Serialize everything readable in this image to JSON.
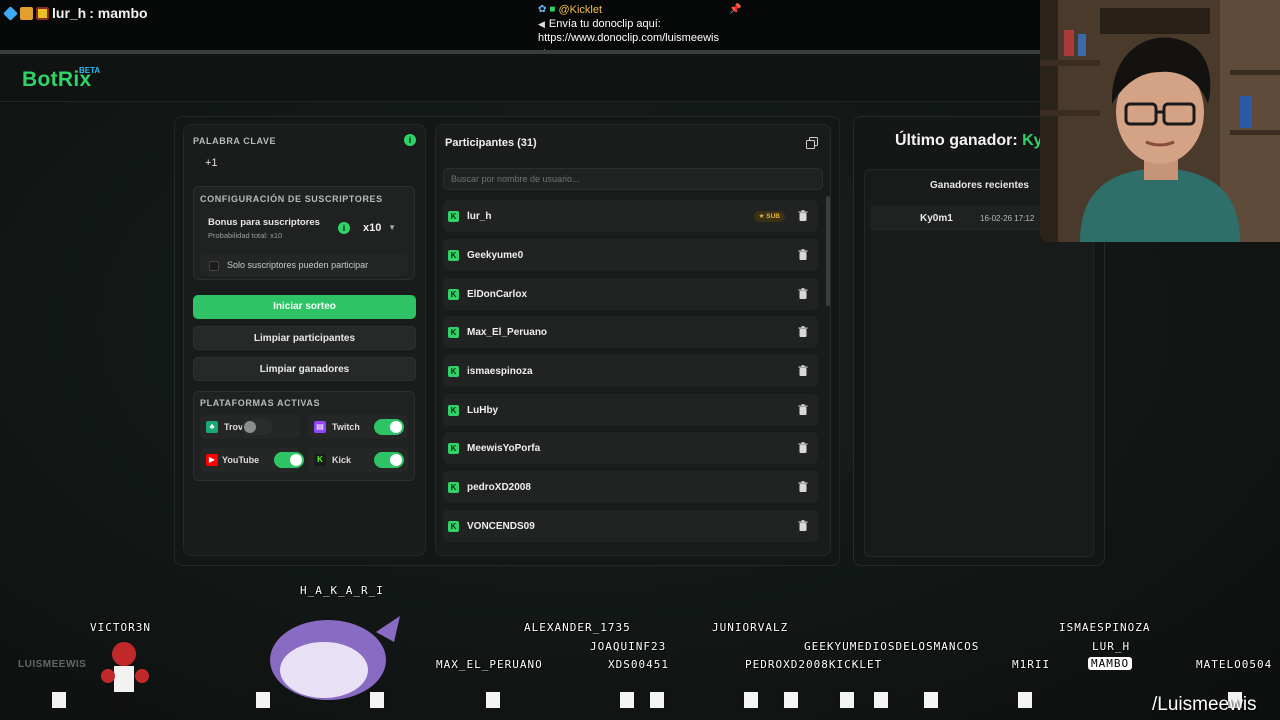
{
  "stream": {
    "chat_user": "lur_h",
    "chat_message": ": mambo",
    "alert_user": "@Kicklet",
    "alert_line1": "Envía tu donoclip aquí:",
    "alert_line2": "https://www.donoclip.com/luismeewis",
    "watermark": "/Luismeewis",
    "brand_watermark": "LUISMEEWIS"
  },
  "app": {
    "logo": "BotRix",
    "beta": "BETA"
  },
  "left_panel": {
    "keyword_label": "PALABRA CLAVE",
    "keyword_value": "+1",
    "sub_config_label": "CONFIGURACIÓN DE SUSCRIPTORES",
    "bonus_title": "Bonus para suscriptores",
    "bonus_sub": "Probabilidad total: x10",
    "multiplier": "x10",
    "sub_only_label": "Solo suscriptores pueden participar",
    "start_button": "Iniciar sorteo",
    "clear_participants": "Limpiar participantes",
    "clear_winners": "Limpiar ganadores",
    "platforms_label": "PLATAFORMAS ACTIVAS",
    "platforms": [
      {
        "name": "Trovo",
        "enabled": false,
        "color": "#19a974"
      },
      {
        "name": "Twitch",
        "enabled": true,
        "color": "#9146ff"
      },
      {
        "name": "YouTube",
        "enabled": true,
        "color": "#ff0000"
      },
      {
        "name": "Kick",
        "enabled": true,
        "color": "#53fc18"
      }
    ]
  },
  "participants": {
    "title": "Participantes (31)",
    "search_placeholder": "Buscar por nombre de usuario...",
    "sub_tag": "★ SUB",
    "list": [
      "lur_h",
      "Geekyume0",
      "ElDonCarlox",
      "Max_El_Peruano",
      "ismaespinoza",
      "LuHby",
      "MeewisYoPorfa",
      "pedroXD2008",
      "VONCENDS09"
    ]
  },
  "winners": {
    "title_prefix": "Último ganador: ",
    "last_winner": "Ky0",
    "recent_title": "Ganadores recientes",
    "recent": [
      {
        "name": "Ky0m1",
        "date": "16-02-26 17:12"
      }
    ]
  },
  "bottom_names": [
    "H_A_K_A_R_I",
    "VICTOR3N",
    "ALEXANDER_1735",
    "JUNIORVALZ",
    "ISMAESPINOZA",
    "JOAQUINF23",
    "GEEKYUMEDIOSDELOSMANCOS",
    "LUR_H",
    "MAX_EL_PERUANO",
    "XDS00451",
    "PEDROXD2008KICKLET",
    "M1RII",
    "MAMBO",
    "MATELO0504"
  ],
  "colors": {
    "accent": "#2fd36a",
    "bg": "#121715",
    "panel": "#1a1c1c"
  }
}
